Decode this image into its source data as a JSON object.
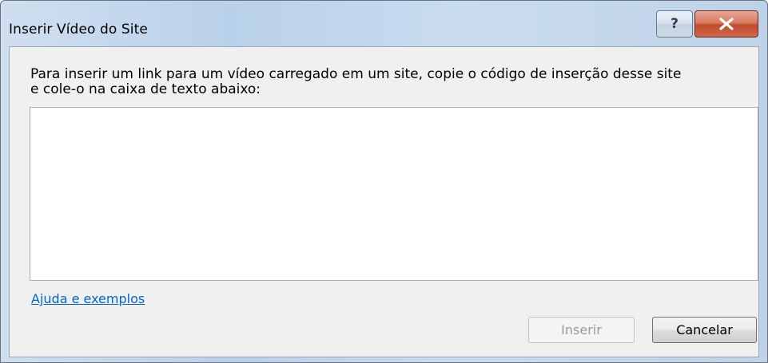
{
  "window": {
    "title": "Inserir Vídeo do Site",
    "help_button_glyph": "?",
    "close_button_glyph": "X"
  },
  "body": {
    "instructions": "Para inserir um link para um vídeo carregado em um site, copie o código de inserção desse site\ne cole-o na caixa de texto abaixo:",
    "embed_code_value": "",
    "help_link": "Ajuda e exemplos"
  },
  "buttons": {
    "insert_label": "Inserir",
    "insert_enabled": false,
    "cancel_label": "Cancelar"
  },
  "colors": {
    "link": "#0066cc",
    "close_button": "#c14a2b",
    "disabled_text": "#9a9a9a"
  },
  "icons": {
    "help": "help-icon",
    "close": "close-icon"
  }
}
